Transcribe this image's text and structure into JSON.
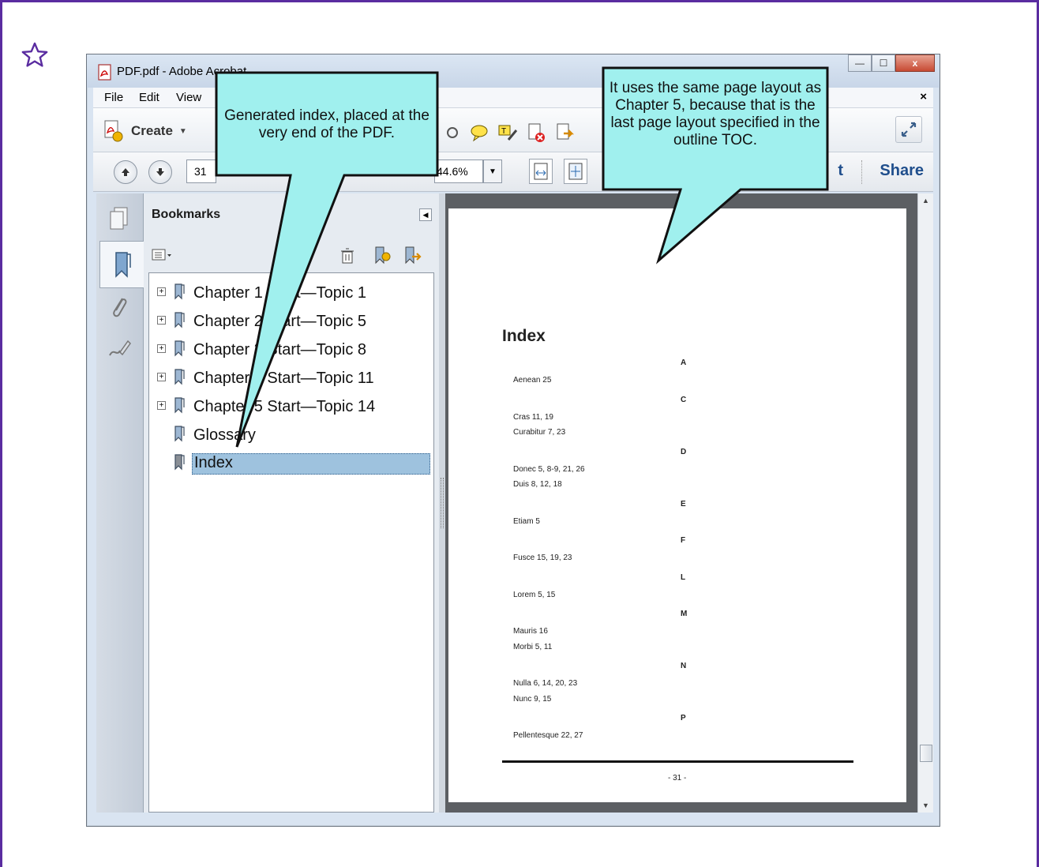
{
  "window": {
    "title": "PDF.pdf - Adobe Acrobat",
    "minimize": "—",
    "maximize": "☐",
    "close": "x"
  },
  "menu": {
    "items": [
      "File",
      "Edit",
      "View"
    ],
    "close": "×"
  },
  "toolbar": {
    "create_label": "Create",
    "page_number": "31",
    "zoom": "44.6%",
    "share_label": "Share",
    "partial_label": "t"
  },
  "bookmarks": {
    "title": "Bookmarks",
    "items": [
      {
        "label": "Chapter 1 Start—Topic 1",
        "expandable": true
      },
      {
        "label": "Chapter 2 Start—Topic 5",
        "expandable": true
      },
      {
        "label": "Chapter 3 Start—Topic 8",
        "expandable": true
      },
      {
        "label": "Chapter 4 Start—Topic 11",
        "expandable": true
      },
      {
        "label": "Chapter 5 Start—Topic 14",
        "expandable": true
      },
      {
        "label": "Glossary",
        "expandable": false
      },
      {
        "label": "Index",
        "expandable": false,
        "selected": true
      }
    ]
  },
  "page": {
    "heading": "Index",
    "groups": [
      {
        "letter": "A",
        "entries": [
          "Aenean  25"
        ]
      },
      {
        "letter": "C",
        "entries": [
          "Cras  11, 19",
          "Curabitur  7, 23"
        ]
      },
      {
        "letter": "D",
        "entries": [
          "Donec  5, 8-9, 21, 26",
          "Duis  8, 12, 18"
        ]
      },
      {
        "letter": "E",
        "entries": [
          "Etiam  5"
        ]
      },
      {
        "letter": "F",
        "entries": [
          "Fusce  15, 19, 23"
        ]
      },
      {
        "letter": "L",
        "entries": [
          "Lorem  5, 15"
        ]
      },
      {
        "letter": "M",
        "entries": [
          "Mauris  16",
          "Morbi  5, 11"
        ]
      },
      {
        "letter": "N",
        "entries": [
          "Nulla  6, 14, 20, 23",
          "Nunc  9, 15"
        ]
      },
      {
        "letter": "P",
        "entries": [
          "Pellentesque  22, 27"
        ]
      }
    ],
    "footer": "- 31 -"
  },
  "callouts": {
    "left": "Generated index, placed at the very end of the PDF.",
    "right": "It uses the same page layout as Chapter 5, because that is the last page layout specified in the outline TOC."
  },
  "colors": {
    "frame": "#5a2ca0",
    "callout_fill": "#a0f0ee",
    "selection": "#9ec2de",
    "share": "#1f4e8c"
  }
}
